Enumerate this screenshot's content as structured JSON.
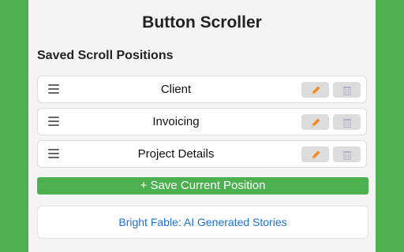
{
  "header": {
    "title": "Button Scroller"
  },
  "section": {
    "title": "Saved Scroll Positions"
  },
  "positions": [
    {
      "label": "Client"
    },
    {
      "label": "Invoicing"
    },
    {
      "label": "Project Details"
    }
  ],
  "icons": {
    "handle": "drag-handle-icon",
    "edit": "pencil-icon",
    "delete": "trash-icon"
  },
  "actions": {
    "save_label": "+ Save Current Position"
  },
  "promo": {
    "link_text": "Bright Fable: AI Generated Stories"
  },
  "colors": {
    "background": "#4caf50",
    "panel": "#f4f4f4",
    "accent_green": "#4caf50",
    "pencil": "#f08a24",
    "link": "#1e73d9"
  }
}
